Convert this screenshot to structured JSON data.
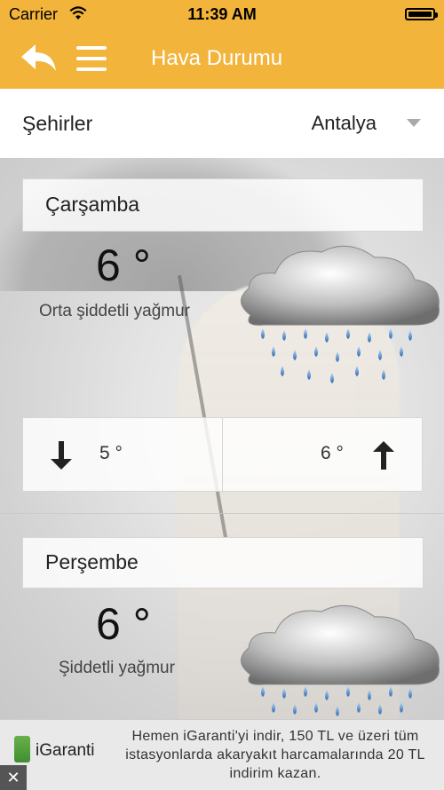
{
  "status": {
    "carrier": "Carrier",
    "time": "11:39 AM"
  },
  "nav": {
    "title": "Hava Durumu",
    "back_icon": "back-arrow-icon",
    "menu_icon": "hamburger-menu-icon"
  },
  "city": {
    "label": "Şehirler",
    "selected": "Antalya"
  },
  "days": [
    {
      "name": "Çarşamba",
      "temp": "6 °",
      "description": "Orta şiddetli yağmur",
      "min": "5 °",
      "max": "6 °",
      "icon": "rain-cloud-icon"
    },
    {
      "name": "Perşembe",
      "temp": "6 °",
      "description": "Şiddetli yağmur",
      "icon": "rain-cloud-icon"
    }
  ],
  "ad": {
    "brand": "iGaranti",
    "text": "Hemen iGaranti'yi indir, 150 TL ve üzeri tüm istasyonlarda akaryakıt harcamalarında 20 TL indirim kazan.",
    "close": "✕"
  },
  "colors": {
    "accent": "#f2b43a"
  }
}
